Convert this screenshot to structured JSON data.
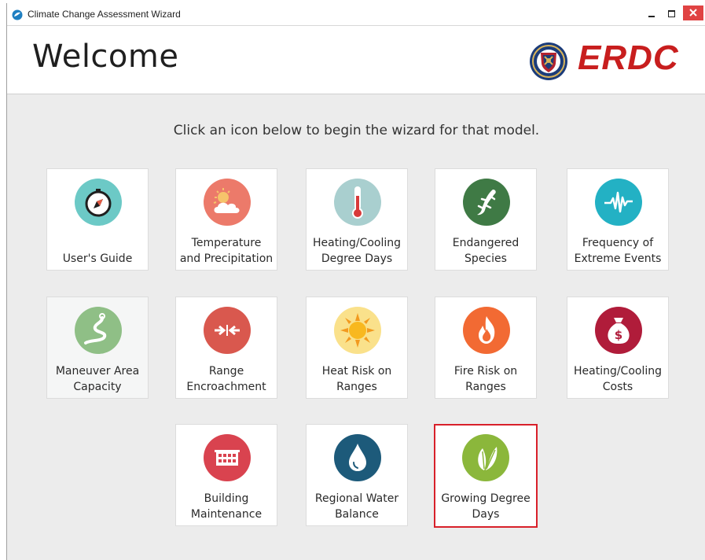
{
  "window": {
    "title": "Climate Change Assessment Wizard"
  },
  "header": {
    "heading": "Welcome",
    "logo_text": "ERDC",
    "brand_color": "#c81e1e"
  },
  "instructions": "Click an icon below to begin the wizard for that model.",
  "tiles": [
    {
      "label": "User's Guide",
      "icon": "compass-icon",
      "color": "#6cc9c6"
    },
    {
      "label": "Temperature\nand Precipitation",
      "icon": "sun-cloud-icon",
      "color": "#ec7a6a"
    },
    {
      "label": "Heating/Cooling\nDegree Days",
      "icon": "thermometer-icon",
      "color": "#a9cfcf"
    },
    {
      "label": "Endangered\nSpecies",
      "icon": "lizard-icon",
      "color": "#3f7a45"
    },
    {
      "label": "Frequency of\nExtreme Events",
      "icon": "pulse-icon",
      "color": "#23b1c4"
    },
    {
      "label": "Maneuver Area\nCapacity",
      "icon": "winding-road-icon",
      "color": "#8fbf86"
    },
    {
      "label": "Range\nEncroachment",
      "icon": "arrows-inward-icon",
      "color": "#d9584e"
    },
    {
      "label": "Heat Risk on\nRanges",
      "icon": "sun-icon",
      "color": "#fae18b"
    },
    {
      "label": "Fire Risk on\nRanges",
      "icon": "flame-icon",
      "color": "#f26a33"
    },
    {
      "label": "Heating/Cooling\nCosts",
      "icon": "money-bag-icon",
      "color": "#b01c3a"
    },
    {
      "label": "Building\nMaintenance",
      "icon": "building-icon",
      "color": "#d9434f"
    },
    {
      "label": "Regional Water\nBalance",
      "icon": "water-drop-icon",
      "color": "#1d5a7a"
    },
    {
      "label": "Growing Degree\nDays",
      "icon": "leaf-icon",
      "color": "#8bb73b"
    }
  ],
  "selected_tile": "Growing Degree Days",
  "selection_color": "#d8202a"
}
